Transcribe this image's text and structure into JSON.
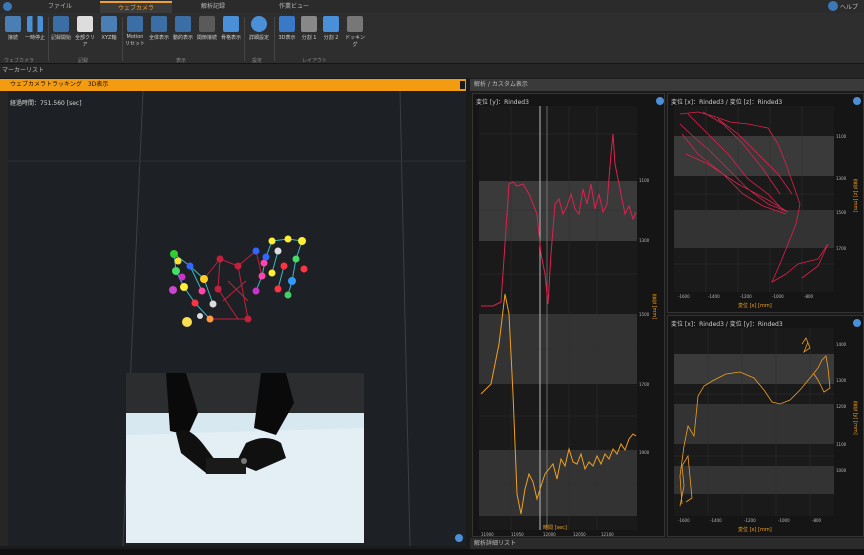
{
  "app": {
    "top_right": "ヘルプ"
  },
  "tabs": [
    {
      "label": "ファイル",
      "active": false
    },
    {
      "label": "ウェブカメラ",
      "active": true
    },
    {
      "label": "解析記録",
      "active": false
    },
    {
      "label": "作業ビュー",
      "active": false
    }
  ],
  "ribbon": {
    "buttons": [
      {
        "label": "接続",
        "icon": "connect-icon"
      },
      {
        "label": "一時停止",
        "icon": "pause-icon"
      },
      {
        "label": "記録開始",
        "icon": "record-icon"
      },
      {
        "label": "全部クリア",
        "icon": "clear-icon"
      },
      {
        "label": "XYZ軸",
        "icon": "axis-icon"
      },
      {
        "label": "Motion リセット",
        "icon": "reset-icon"
      },
      {
        "label": "全体表示",
        "icon": "fit-icon"
      },
      {
        "label": "動的表示",
        "icon": "dynamic-icon"
      },
      {
        "label": "関節接続",
        "icon": "joint-icon"
      },
      {
        "label": "骨格表示",
        "icon": "skeleton-icon"
      },
      {
        "label": "詳細設定",
        "icon": "gear-icon"
      },
      {
        "label": "3D表示",
        "icon": "3d-icon"
      },
      {
        "label": "分割 1",
        "icon": "layout1-icon"
      },
      {
        "label": "分割 2",
        "icon": "layout2-icon"
      },
      {
        "label": "ドッキング",
        "icon": "dock-icon"
      }
    ],
    "groups": [
      "ウェブカメラ",
      "記録",
      "表示",
      "設定",
      "レイアウト"
    ]
  },
  "subbar": {
    "label": "マーカーリスト"
  },
  "left_panel": {
    "title": "ウェブカメラトラッキング　3D表示",
    "elapsed_label": "経過時間：",
    "elapsed_value": "751.560 [sec]"
  },
  "right_panel": {
    "title": "解析 / カスタム表示",
    "charts": [
      {
        "title": "変位 [y]：Rinded3",
        "xlabel": "時間 [sec]",
        "ylabel": "変位 [mm]"
      },
      {
        "title": "変位 [x]：Rinded3 / 変位 [z]：Rinded3",
        "xlabel": "変位 [x] [mm]",
        "ylabel": "変位 [z] [mm]"
      },
      {
        "title": "変位 [x]：Rinded3 / 変位 [y]：Rinded3",
        "xlabel": "変位 [x] [mm]",
        "ylabel": "変位 [y] [mm]"
      }
    ],
    "bottom_label": "解析詳細リスト"
  },
  "colors": {
    "accent": "#f39c12",
    "pink": "#e0204d",
    "orange": "#f0a020",
    "blue": "#4a90d9"
  }
}
